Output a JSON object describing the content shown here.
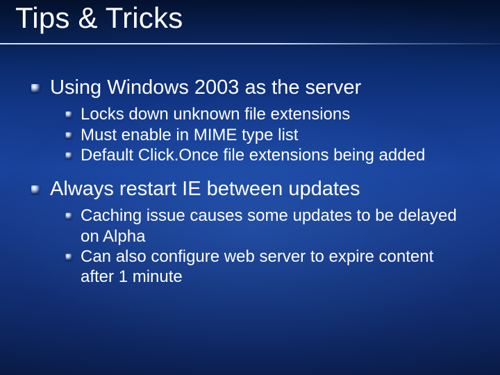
{
  "title": "Tips & Tricks",
  "items": [
    {
      "text": "Using Windows 2003 as the server",
      "sub": [
        {
          "text": "Locks down unknown file extensions"
        },
        {
          "text": "Must enable in MIME type list"
        },
        {
          "text": "Default Click.Once file extensions being added"
        }
      ]
    },
    {
      "text": "Always restart IE between updates",
      "sub": [
        {
          "text": "Caching issue causes some updates to be delayed on Alpha"
        },
        {
          "text": "Can also configure web server to expire content after 1 minute"
        }
      ]
    }
  ]
}
